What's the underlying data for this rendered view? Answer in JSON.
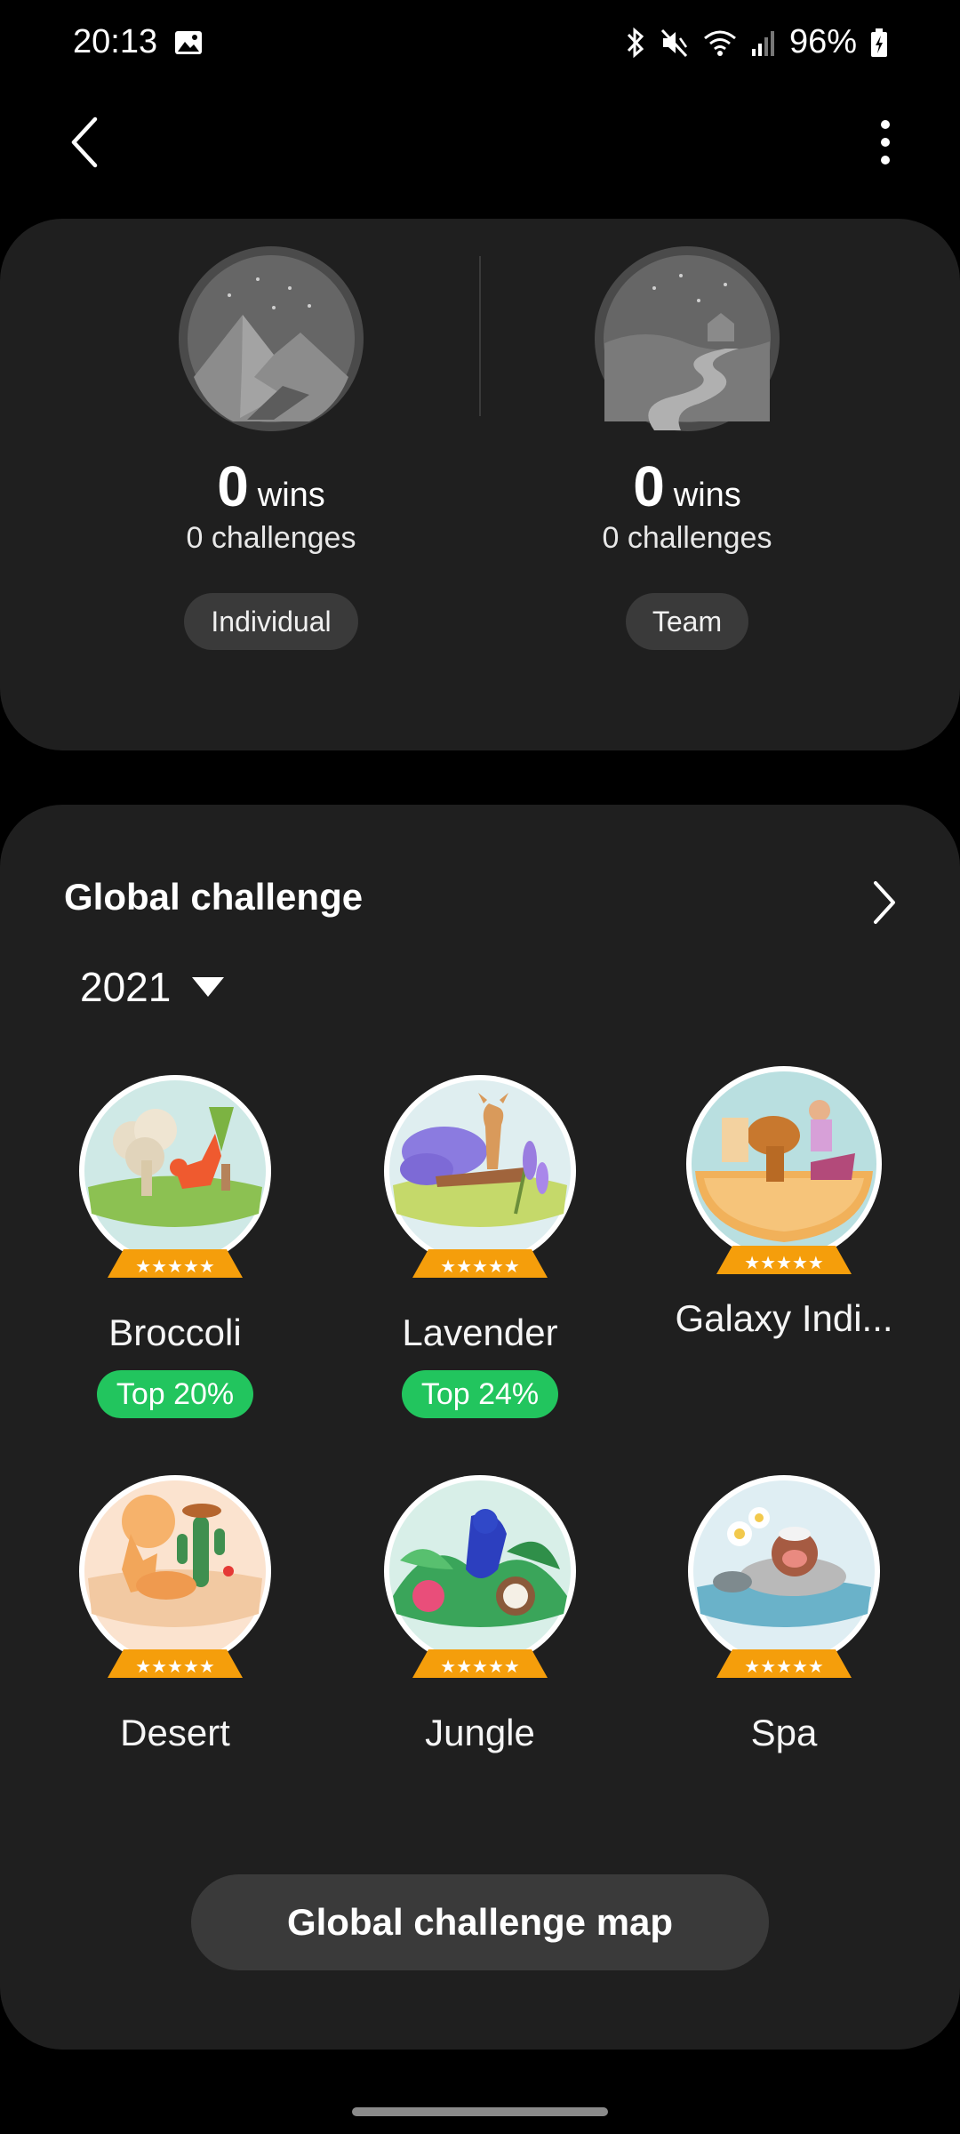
{
  "status_bar": {
    "time": "20:13",
    "battery": "96%"
  },
  "stats": {
    "individual": {
      "wins_count": "0",
      "wins_label": "wins",
      "challenges": "0 challenges",
      "type": "Individual"
    },
    "team": {
      "wins_count": "0",
      "wins_label": "wins",
      "challenges": "0 challenges",
      "type": "Team"
    }
  },
  "global_challenge": {
    "title": "Global challenge",
    "year": "2021",
    "badges": [
      {
        "name": "Broccoli",
        "rank": "Top 20%"
      },
      {
        "name": "Lavender",
        "rank": "Top 24%"
      },
      {
        "name": "Galaxy Indi...",
        "rank": ""
      },
      {
        "name": "Desert",
        "rank": ""
      },
      {
        "name": "Jungle",
        "rank": ""
      },
      {
        "name": "Spa",
        "rank": ""
      }
    ],
    "map_button": "Global challenge map"
  },
  "icons": {
    "back": "back-arrow-icon",
    "more": "more-vertical-icon",
    "chevron": "chevron-right-icon",
    "dropdown": "dropdown-triangle-icon"
  },
  "colors": {
    "background": "#000000",
    "card": "#1f1f1f",
    "chip": "#3a3a3a",
    "rank_badge": "#22c55e",
    "globe_base": "#f59e0b"
  }
}
